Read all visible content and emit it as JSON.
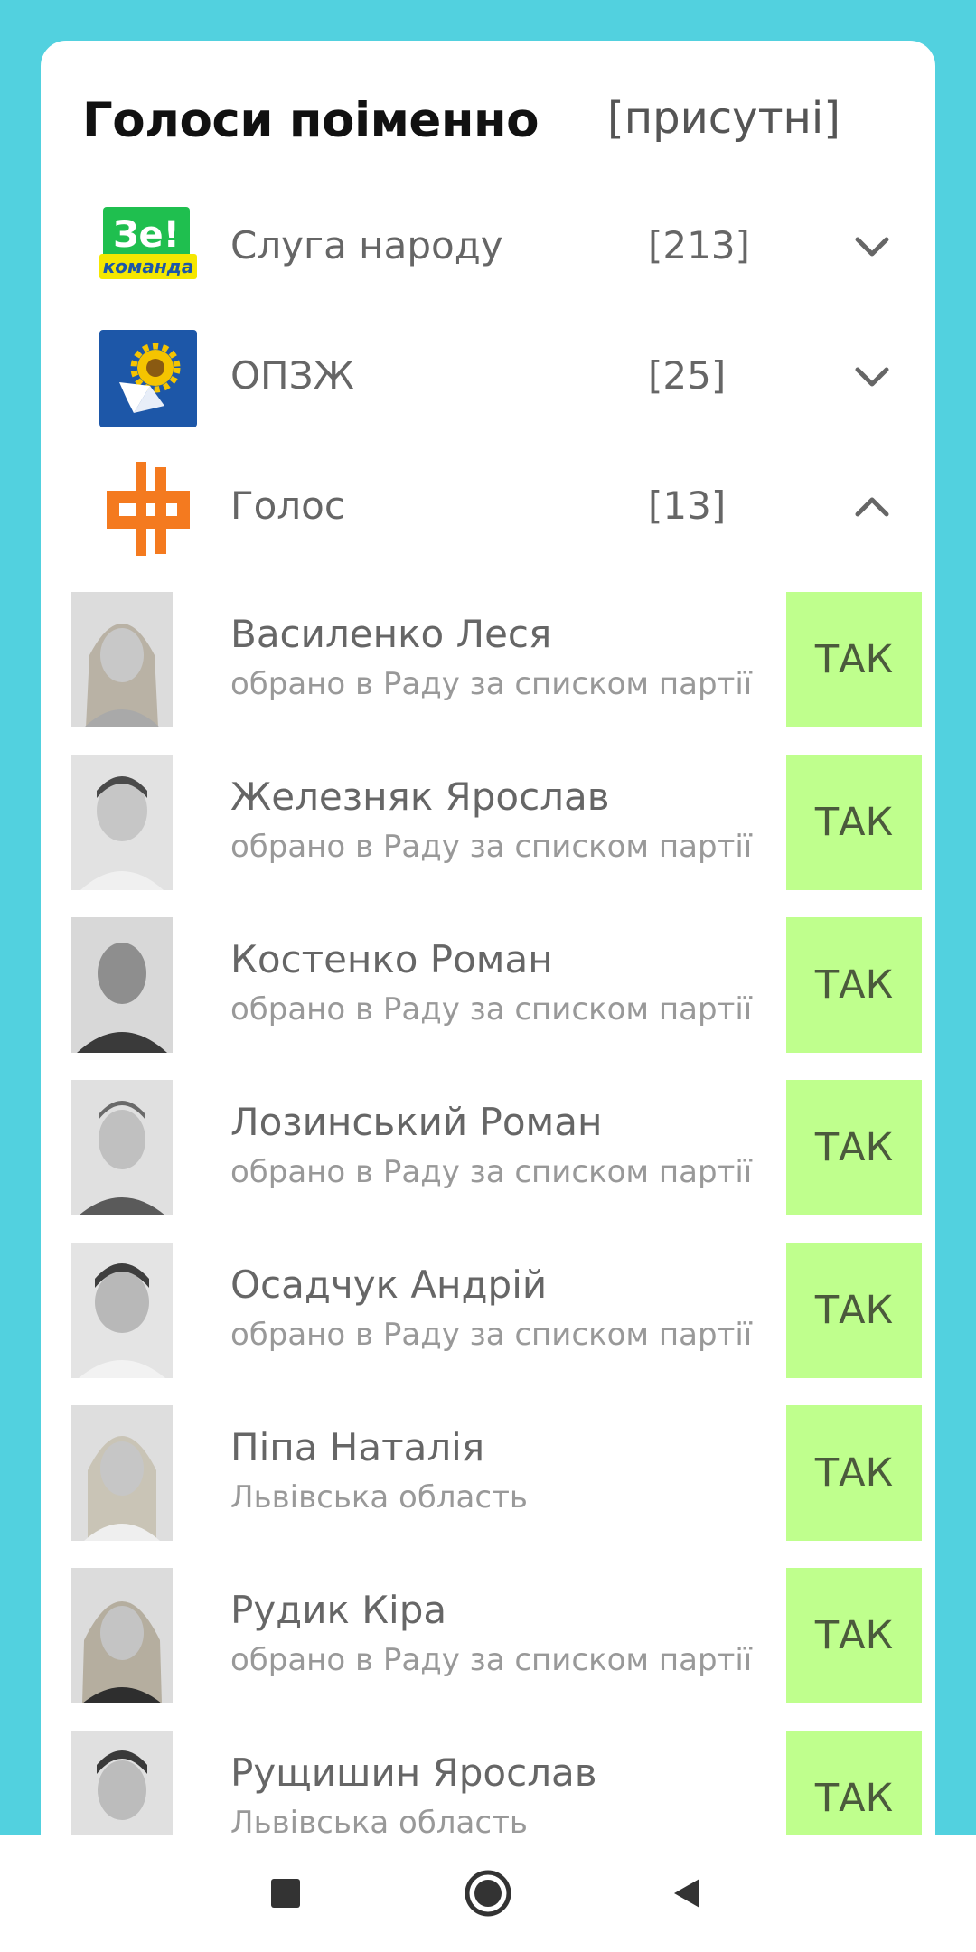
{
  "header": {
    "title": "Голоси поіменно",
    "filter_label": "[присутні]"
  },
  "parties": [
    {
      "name": "Слуга народу",
      "count": "[213]",
      "logo_text_top": "Зе!",
      "logo_text_bottom": "команда",
      "logo_icon": "ze-komanda-logo",
      "expanded": false
    },
    {
      "name": "ОПЗЖ",
      "count": "[25]",
      "logo_icon": "opzh-sunflower-logo",
      "expanded": false
    },
    {
      "name": "Голос",
      "count": "[13]",
      "logo_icon": "holos-logo",
      "expanded": true
    }
  ],
  "members": [
    {
      "name": "Василенко Леся",
      "desc": "обрано в Раду за списком партії",
      "vote": "ТАК"
    },
    {
      "name": "Железняк Ярослав",
      "desc": "обрано в Раду за списком партії",
      "vote": "ТАК"
    },
    {
      "name": "Костенко Роман",
      "desc": "обрано в Раду за списком партії",
      "vote": "ТАК"
    },
    {
      "name": "Лозинський Роман",
      "desc": "обрано в Раду за списком партії",
      "vote": "ТАК"
    },
    {
      "name": "Осадчук Андрій",
      "desc": "обрано в Раду за списком партії",
      "vote": "ТАК"
    },
    {
      "name": "Піпа Наталія",
      "desc": "Львівська область",
      "vote": "ТАК"
    },
    {
      "name": "Рудик Кіра",
      "desc": "обрано в Раду за списком партії",
      "vote": "ТАК"
    },
    {
      "name": "Рущишин Ярослав",
      "desc": "Львівська область",
      "vote": "ТАК"
    }
  ],
  "colors": {
    "background": "#52d1df",
    "vote_yes": "#bfff8d",
    "holos_orange": "#f47a1f",
    "ze_green": "#1fbf4f",
    "ze_yellow": "#f5e700",
    "opzh_blue": "#1d57a8"
  },
  "navbar": {
    "items": [
      "recent-apps-icon",
      "home-icon",
      "back-icon"
    ]
  }
}
